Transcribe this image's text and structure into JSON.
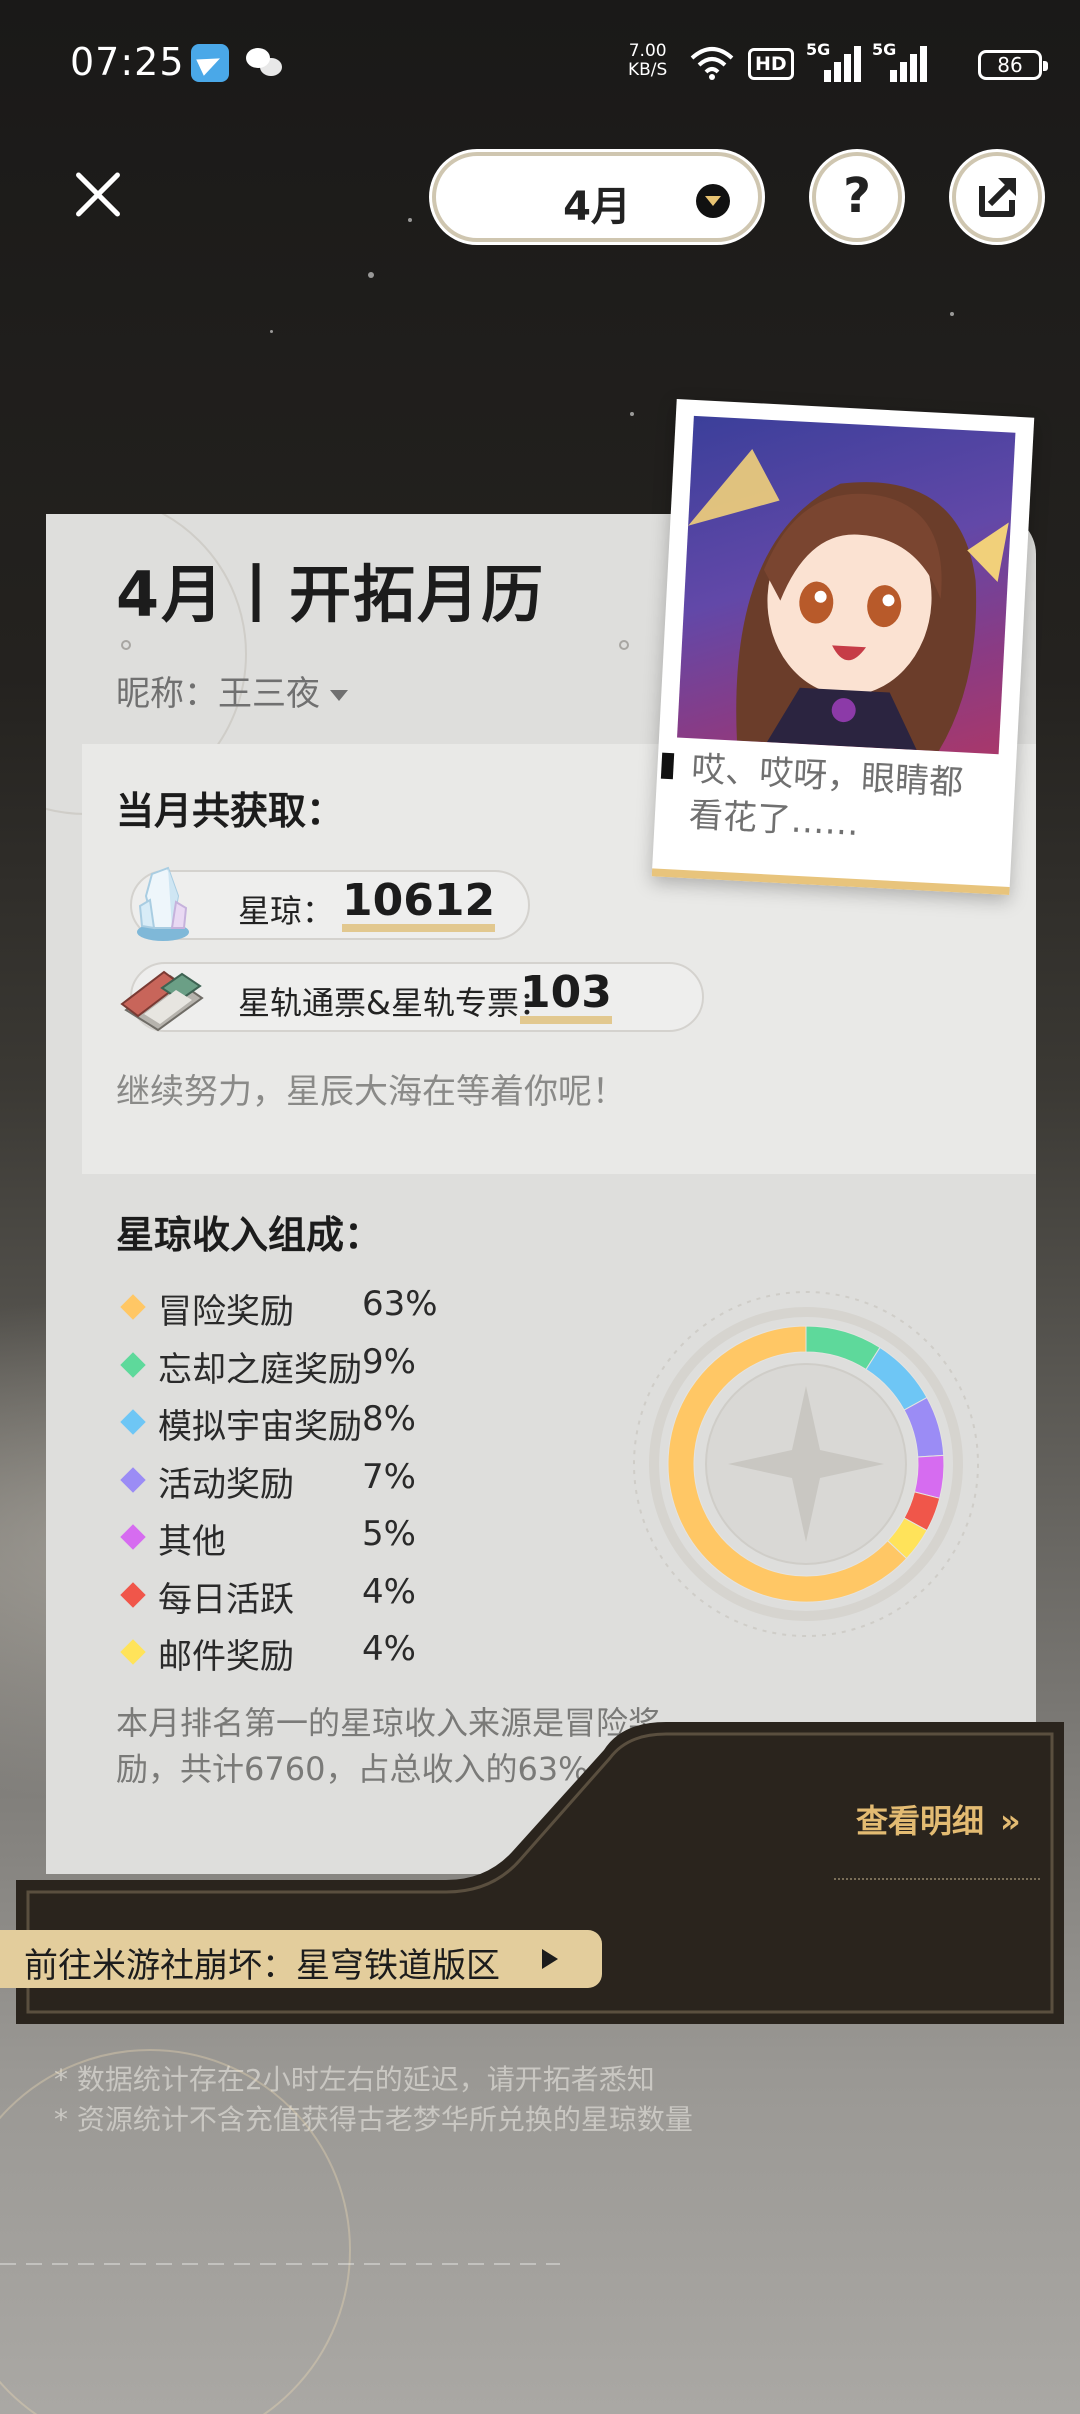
{
  "status_bar": {
    "time": "07:25",
    "net_speed_value": "7.00",
    "net_speed_unit": "KB/S",
    "hd": "HD",
    "sim1": "5G",
    "sim2": "5G",
    "battery": "86"
  },
  "header": {
    "month": "4月",
    "help_label": "?"
  },
  "card": {
    "title": "4月丨开拓月历",
    "nickname": "昵称：王三夜",
    "speech": "哎、哎呀，眼睛都看花了……",
    "summary_heading": "当月共获取：",
    "jade_label": "星琼：",
    "jade_value": "10612",
    "pass_label": "星轨通票&星轨专票：",
    "pass_value": "103",
    "encourage": "继续努力，星辰大海在等着你呢！",
    "breakdown_heading": "星琼收入组成：",
    "note": "本月排名第一的星琼收入来源是冒险奖励，共计6760，占总收入的63%。"
  },
  "chart_data": {
    "type": "pie",
    "categories": [
      "冒险奖励",
      "忘却之庭奖励",
      "模拟宇宙奖励",
      "活动奖励",
      "其他",
      "每日活跃",
      "邮件奖励"
    ],
    "percent_labels": [
      "63%",
      "9%",
      "8%",
      "7%",
      "5%",
      "4%",
      "4%"
    ],
    "values": [
      63,
      9,
      8,
      7,
      5,
      4,
      4
    ],
    "colors": [
      "#ffc765",
      "#5ed99b",
      "#6ec6f5",
      "#9b8cf5",
      "#d66cf0",
      "#f0564a",
      "#ffe35a"
    ]
  },
  "detail": {
    "link": "查看明细",
    "arrows": "»"
  },
  "community": {
    "label": "前往米游社崩坏：星穹铁道版区"
  },
  "footnotes": [
    "* 数据统计存在2小时左右的延迟，请开拓者悉知",
    "* 资源统计不含充值获得古老梦华所兑换的星琼数量"
  ],
  "icons": [
    "close-icon",
    "chevron-down-icon",
    "help-icon",
    "share-icon",
    "stellar-jade-icon",
    "star-rail-pass-icon",
    "play-arrow-icon"
  ]
}
